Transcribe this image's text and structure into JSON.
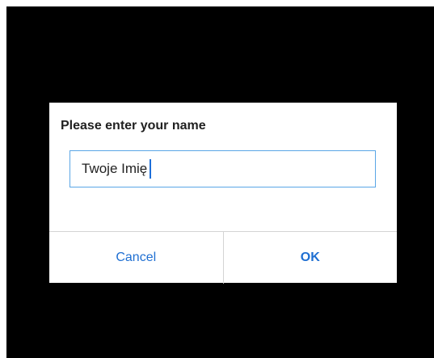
{
  "dialog": {
    "title": "Please enter your name",
    "input_value": "Twoje Imię",
    "cancel_label": "Cancel",
    "ok_label": "OK"
  },
  "colors": {
    "backdrop": "#000000",
    "accent": "#1f6fd2",
    "input_border": "#5aa6e6"
  }
}
